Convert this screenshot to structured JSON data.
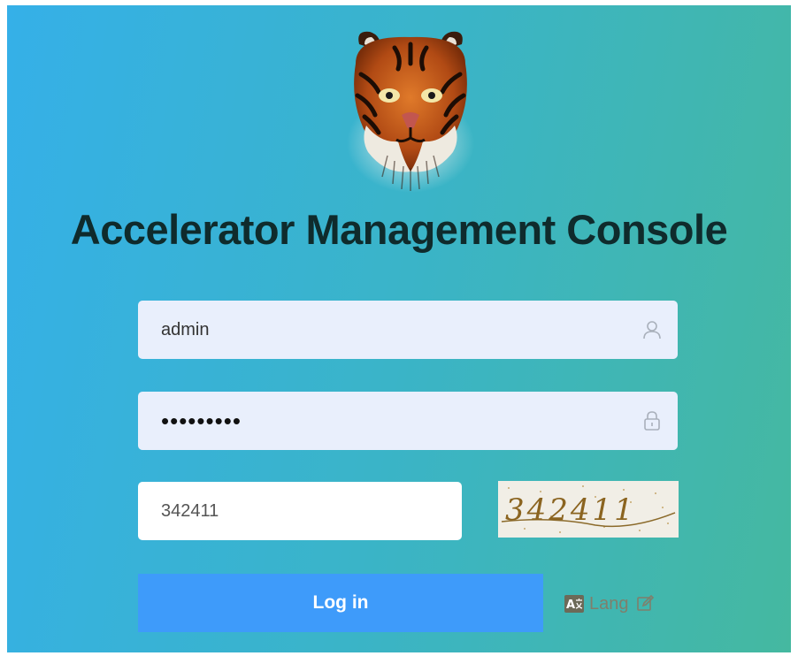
{
  "title": "Accelerator Management Console",
  "logo_icon": "tiger-head-logo",
  "username": {
    "value": "admin",
    "icon": "user-icon"
  },
  "password": {
    "value": "•••••••••",
    "icon": "lock-icon"
  },
  "captcha": {
    "value": "342411",
    "image_text": "342411"
  },
  "login_button": {
    "label": "Log in"
  },
  "lang": {
    "label": "Lang",
    "badge_icon": "translate-icon",
    "edit_icon": "edit-icon"
  },
  "colors": {
    "gradient_start": "#35b0e8",
    "gradient_end": "#45b8a0",
    "button": "#3e9bfa",
    "title": "#0f2b2c"
  }
}
